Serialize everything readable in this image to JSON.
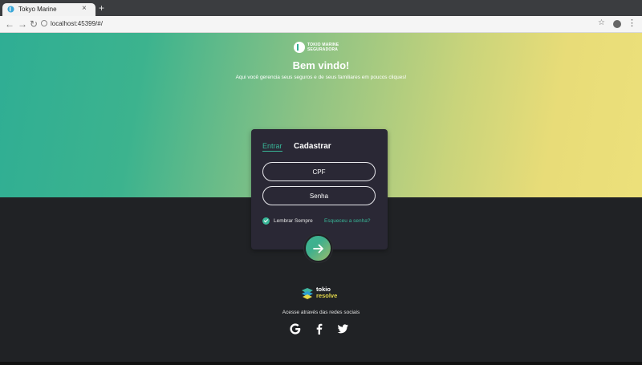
{
  "browser": {
    "tab_title": "Tokyo Marine",
    "close_glyph": "×",
    "new_tab_glyph": "+",
    "back_glyph": "←",
    "forward_glyph": "→",
    "reload_glyph": "↻",
    "url": "localhost:45399/#/",
    "star_glyph": "☆",
    "menu_glyph": "⋮"
  },
  "hero": {
    "logo_line1": "TOKIO MARINE",
    "logo_line2": "SEGURADORA",
    "welcome": "Bem vindo!",
    "subtitle": "Aqui você gerencia seus seguros e de seus familiares em poucos cliques!",
    "gradient_colors": [
      "#2fae94",
      "#8fc384",
      "#ece07a"
    ]
  },
  "login": {
    "tab_login": "Entrar",
    "tab_register": "Cadastrar",
    "cpf_placeholder": "CPF",
    "password_placeholder": "Senha",
    "remember_label": "Lembrar Sempre",
    "forgot_link": "Esqueceu a senha?",
    "submit_icon": "arrow-right-icon",
    "accent_color": "#38b798"
  },
  "footer": {
    "brand_line1": "tokio",
    "brand_line2": "resolve",
    "social_text": "Acesse através das redes sociais",
    "social_icons": [
      "google-icon",
      "facebook-icon",
      "twitter-icon"
    ]
  }
}
